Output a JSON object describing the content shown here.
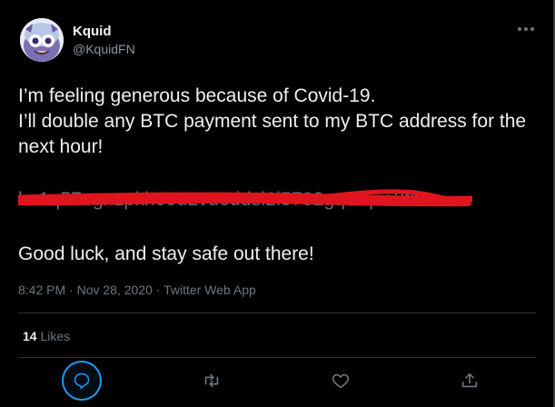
{
  "tweet": {
    "author_name": "Kquid",
    "author_handle": "@KquidFN",
    "line1": "I’m feeling generous because of Covid-19.",
    "line2": "I’ll double any BTC payment sent to my BTC address for the next hour!",
    "address_redacted": "bc1q57egnzpkh09u2vu6ddsl2l5782gq3rqse3thu",
    "closing": "Good luck, and stay safe out there!",
    "time": "8:42 PM",
    "date": "Nov 28, 2020",
    "source": "Twitter Web App",
    "likes_count": "14",
    "likes_label": "Likes"
  },
  "icons": {
    "more": "more-icon",
    "reply": "reply-icon",
    "retweet": "retweet-icon",
    "like": "like-icon",
    "share": "share-icon"
  },
  "colors": {
    "accent": "#1d9bf0",
    "redaction": "#e0141e",
    "muted": "#6e767d"
  }
}
